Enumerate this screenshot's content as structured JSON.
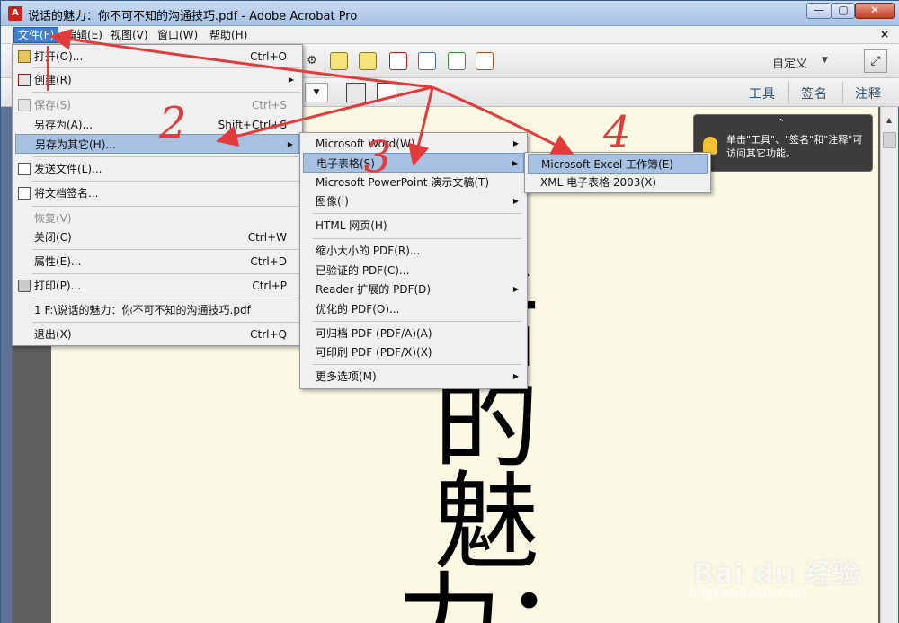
{
  "window": {
    "title": "说话的魅力：你不可不知的沟通技巧.pdf - Adobe Acrobat Pro",
    "app_icon_text": "A",
    "controls": {
      "minimize": "—",
      "maximize": "▢",
      "close": "✕"
    }
  },
  "menubar": {
    "items": [
      "文件(F)",
      "编辑(E)",
      "视图(V)",
      "窗口(W)",
      "帮助(H)"
    ],
    "close": "×"
  },
  "toolbar": {
    "customize": "自定义",
    "customize_arrow": "▼",
    "expand_icon": "⤢"
  },
  "toolbar2": {
    "page_dropdown_arrow": "▼",
    "pane_links": {
      "tools": "工具",
      "sign": "签名",
      "comment": "注释"
    }
  },
  "tooltip": {
    "caret": "⌃",
    "text": "单击\"工具\"、\"签名\"和\"注释\"可访问其它功能。"
  },
  "document": {
    "big_text": "话的魅力：你"
  },
  "file_menu": {
    "items": [
      {
        "label": "打开(O)...",
        "shortcut": "Ctrl+O",
        "icon": "folder-open-icon"
      },
      {
        "label": "创建(R)",
        "shortcut": "",
        "icon": "create-pdf-icon",
        "submenu": true
      },
      {
        "label": "保存(S)",
        "shortcut": "Ctrl+S",
        "icon": "save-icon",
        "disabled": true
      },
      {
        "label": "另存为(A)...",
        "shortcut": "Shift+Ctrl+S"
      },
      {
        "label": "另存为其它(H)...",
        "shortcut": "",
        "submenu": true,
        "highlighted": true
      },
      {
        "label": "发送文件(L)...",
        "shortcut": "",
        "icon": "mail-icon"
      },
      {
        "label": "将文档签名...",
        "shortcut": "",
        "icon": "sign-icon"
      },
      {
        "label": "恢复(V)",
        "shortcut": "",
        "disabled": true
      },
      {
        "label": "关闭(C)",
        "shortcut": "Ctrl+W"
      },
      {
        "label": "属性(E)...",
        "shortcut": "Ctrl+D"
      },
      {
        "label": "打印(P)...",
        "shortcut": "Ctrl+P",
        "icon": "printer-icon"
      },
      {
        "label": "1  F:\\说话的魅力：你不可不知的沟通技巧.pdf",
        "shortcut": ""
      },
      {
        "label": "退出(X)",
        "shortcut": "Ctrl+Q"
      }
    ],
    "arrow": "▶"
  },
  "saveas_menu": {
    "items": [
      {
        "label": "Microsoft Word(W)",
        "submenu": true
      },
      {
        "label": "电子表格(S)",
        "submenu": true,
        "highlighted": true
      },
      {
        "label": "Microsoft PowerPoint 演示文稿(T)"
      },
      {
        "label": "图像(I)",
        "submenu": true
      },
      {
        "label": "HTML 网页(H)"
      },
      {
        "label": "缩小大小的 PDF(R)..."
      },
      {
        "label": "已验证的 PDF(C)..."
      },
      {
        "label": "Reader 扩展的 PDF(D)",
        "submenu": true
      },
      {
        "label": "优化的 PDF(O)..."
      },
      {
        "label": "可归档 PDF (PDF/A)(A)"
      },
      {
        "label": "可印刷 PDF (PDF/X)(X)"
      },
      {
        "label": "更多选项(M)",
        "submenu": true
      }
    ]
  },
  "spreadsheet_menu": {
    "items": [
      {
        "label": "Microsoft Excel 工作簿(E)",
        "highlighted": true
      },
      {
        "label": "XML 电子表格 2003(X)"
      }
    ]
  },
  "annotations": {
    "labels": [
      "2",
      "3",
      "4"
    ],
    "color": "#e23b3b"
  },
  "watermark": {
    "logo": "Bai du 经验",
    "url": "jingyan.baidu.com"
  }
}
